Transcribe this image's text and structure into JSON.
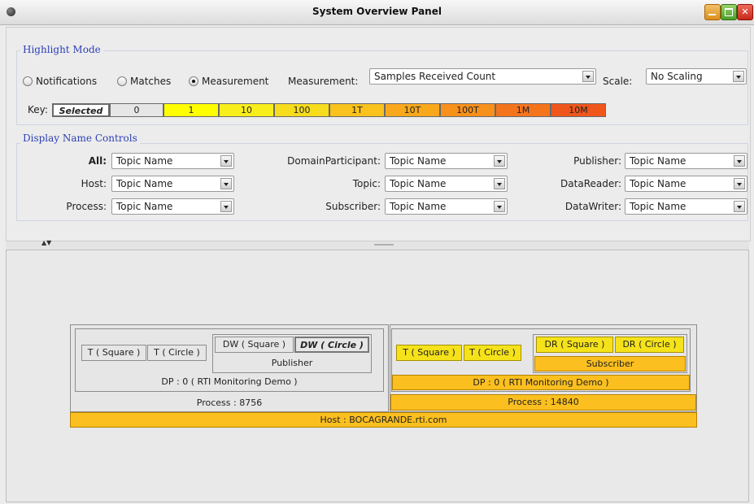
{
  "window": {
    "title": "System Overview Panel"
  },
  "highlight_mode": {
    "title": "Highlight Mode",
    "options": [
      {
        "label": "Notifications",
        "selected": false
      },
      {
        "label": "Matches",
        "selected": false
      },
      {
        "label": "Measurement",
        "selected": true
      }
    ],
    "measurement_label": "Measurement:",
    "measurement_value": "Samples Received Count",
    "scale_label": "Scale:",
    "scale_value": "No Scaling",
    "key_label": "Key:",
    "key": [
      {
        "label": "Selected",
        "color": "#ffffff"
      },
      {
        "label": "0",
        "color": "#e6e6e6"
      },
      {
        "label": "1",
        "color": "#ffff00"
      },
      {
        "label": "10",
        "color": "#f8ee1c"
      },
      {
        "label": "100",
        "color": "#f6dc1c"
      },
      {
        "label": "1T",
        "color": "#f9c21c"
      },
      {
        "label": "10T",
        "color": "#f9a81c"
      },
      {
        "label": "100T",
        "color": "#f8901c"
      },
      {
        "label": "1M",
        "color": "#f4741c"
      },
      {
        "label": "10M",
        "color": "#ef561c"
      }
    ]
  },
  "display_name_controls": {
    "title": "Display Name Controls",
    "rows": [
      {
        "label": "All:",
        "value": "Topic Name"
      },
      {
        "label": "Host:",
        "value": "Topic Name"
      },
      {
        "label": "Process:",
        "value": "Topic Name"
      },
      {
        "label": "DomainParticipant:",
        "value": "Topic Name"
      },
      {
        "label": "Topic:",
        "value": "Topic Name"
      },
      {
        "label": "Subscriber:",
        "value": "Topic Name"
      },
      {
        "label": "Publisher:",
        "value": "Topic Name"
      },
      {
        "label": "DataReader:",
        "value": "Topic Name"
      },
      {
        "label": "DataWriter:",
        "value": "Topic Name"
      }
    ]
  },
  "diagram": {
    "left": {
      "topics": [
        "T ( Square )",
        "T ( Circle )"
      ],
      "writers": [
        "DW ( Square )",
        "DW ( Circle )"
      ],
      "publisher": "Publisher",
      "participant": "DP : 0 ( RTI Monitoring Demo )",
      "process": "Process : 8756"
    },
    "right": {
      "topics": [
        "T ( Square )",
        "T ( Circle )"
      ],
      "readers": [
        "DR ( Square )",
        "DR ( Circle )"
      ],
      "subscriber": "Subscriber",
      "participant": "DP : 0 ( RTI Monitoring Demo )",
      "process": "Process : 14840"
    },
    "host": "Host : BOCAGRANDE.rti.com"
  }
}
